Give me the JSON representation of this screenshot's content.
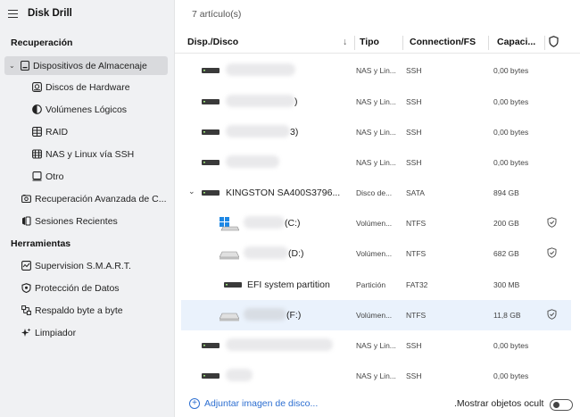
{
  "app": {
    "title": "Disk Drill"
  },
  "sidebar": {
    "recovery_heading": "Recuperación",
    "storage_devices": "Dispositivos de Almacenaje",
    "sub_items": [
      {
        "label": "Discos de Hardware",
        "icon": "hard-disk-icon"
      },
      {
        "label": "Volúmenes Lógicos",
        "icon": "pie-icon"
      },
      {
        "label": "RAID",
        "icon": "raid-icon"
      },
      {
        "label": "NAS y Linux vía SSH",
        "icon": "nas-icon"
      },
      {
        "label": "Otro",
        "icon": "device-icon"
      }
    ],
    "advanced_recovery": "Recuperación Avanzada de C...",
    "recent_sessions": "Sesiones Recientes",
    "tools_heading": "Herramientas",
    "tools": [
      {
        "label": "Supervision S.M.A.R.T.",
        "icon": "smart-icon"
      },
      {
        "label": "Protección de Datos",
        "icon": "shield-icon"
      },
      {
        "label": "Respaldo byte a byte",
        "icon": "backup-icon"
      },
      {
        "label": "Limpiador",
        "icon": "sparkle-icon"
      }
    ]
  },
  "main": {
    "item_count": "7 artículo(s)",
    "columns": {
      "device": "Disp./Disco",
      "type": "Tipo",
      "connection": "Connection/FS",
      "capacity": "Capaci...",
      "sort_arrow": "↓"
    },
    "rows": [
      {
        "name": "",
        "type": "NAS y Lin...",
        "fs": "SSH",
        "cap": "0,00 bytes"
      },
      {
        "name": ")",
        "type": "NAS y Lin...",
        "fs": "SSH",
        "cap": "0,00 bytes"
      },
      {
        "name": "3)",
        "type": "NAS y Lin...",
        "fs": "SSH",
        "cap": "0,00 bytes"
      },
      {
        "name": "",
        "type": "NAS y Lin...",
        "fs": "SSH",
        "cap": "0,00 bytes"
      },
      {
        "name": "KINGSTON SA400S3796...",
        "type": "Disco de...",
        "fs": "SATA",
        "cap": "894 GB"
      },
      {
        "name": "(C:)",
        "type": "Volúmen...",
        "fs": "NTFS",
        "cap": "200 GB"
      },
      {
        "name": "(D:)",
        "type": "Volúmen...",
        "fs": "NTFS",
        "cap": "682 GB"
      },
      {
        "name": "EFI system partition",
        "type": "Partición",
        "fs": "FAT32",
        "cap": "300 MB"
      },
      {
        "name": "(F:)",
        "type": "Volúmen...",
        "fs": "NTFS",
        "cap": "11,8 GB"
      },
      {
        "name": "",
        "type": "NAS y Lin...",
        "fs": "SSH",
        "cap": "0,00 bytes"
      },
      {
        "name": "",
        "type": "NAS y Lin...",
        "fs": "SSH",
        "cap": "0,00 bytes"
      }
    ],
    "footer": {
      "attach_image": "Adjuntar imagen de disco...",
      "show_hidden": ".Mostrar objetos ocult"
    }
  },
  "colors": {
    "accent": "#2d6fd1",
    "sidebar_bg": "#f0f1f3",
    "selected_row": "#eaf2fc"
  }
}
